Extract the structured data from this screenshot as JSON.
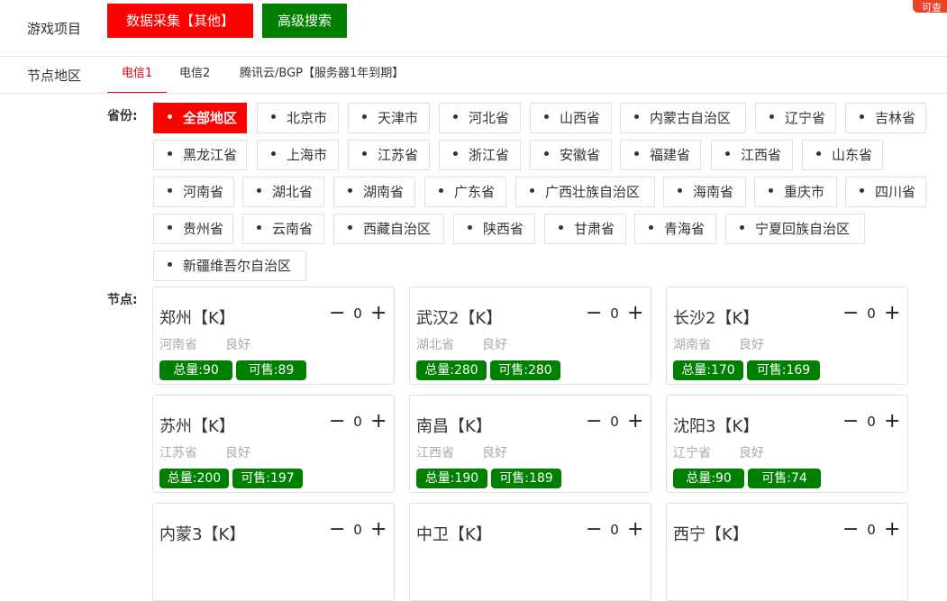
{
  "header": {
    "label": "游戏项目",
    "data_collect_button": "数据采集【其他】",
    "advanced_search_button": "高级搜索",
    "corner_tag": "可查"
  },
  "region": {
    "label": "节点地区",
    "tabs": [
      "电信1",
      "电信2",
      "腾讯云/BGP【服务器1年到期】"
    ],
    "active_tab": "电信1"
  },
  "provinces": {
    "label": "省份:",
    "items": [
      "全部地区",
      "北京市",
      "天津市",
      "河北省",
      "山西省",
      "内蒙古自治区",
      "辽宁省",
      "吉林省",
      "黑龙江省",
      "上海市",
      "江苏省",
      "浙江省",
      "安徽省",
      "福建省",
      "江西省",
      "山东省",
      "河南省",
      "湖北省",
      "湖南省",
      "广东省",
      "广西壮族自治区",
      "海南省",
      "重庆市",
      "四川省",
      "贵州省",
      "云南省",
      "西藏自治区",
      "陕西省",
      "甘肃省",
      "青海省",
      "宁夏回族自治区",
      "新疆维吾尔自治区"
    ],
    "active": "全部地区"
  },
  "nodes": {
    "label": "节点:",
    "cards": [
      {
        "name": "郑州【K】",
        "qty": "0",
        "province": "河南省",
        "status": "良好",
        "total": "总量:90",
        "avail": "可售:89"
      },
      {
        "name": "武汉2【K】",
        "qty": "0",
        "province": "湖北省",
        "status": "良好",
        "total": "总量:280",
        "avail": "可售:280"
      },
      {
        "name": "长沙2【K】",
        "qty": "0",
        "province": "湖南省",
        "status": "良好",
        "total": "总量:170",
        "avail": "可售:169"
      },
      {
        "name": "苏州【K】",
        "qty": "0",
        "province": "江苏省",
        "status": "良好",
        "total": "总量:200",
        "avail": "可售:197"
      },
      {
        "name": "南昌【K】",
        "qty": "0",
        "province": "江西省",
        "status": "良好",
        "total": "总量:190",
        "avail": "可售:189"
      },
      {
        "name": "沈阳3【K】",
        "qty": "0",
        "province": "辽宁省",
        "status": "良好",
        "total": "总量:90",
        "avail": "可售:74"
      },
      {
        "name": "内蒙3【K】",
        "qty": "0",
        "province": "",
        "status": "",
        "total": "",
        "avail": ""
      },
      {
        "name": "中卫【K】",
        "qty": "0",
        "province": "",
        "status": "",
        "total": "",
        "avail": ""
      },
      {
        "name": "西宁【K】",
        "qty": "0",
        "province": "",
        "status": "",
        "total": "",
        "avail": ""
      }
    ]
  },
  "colors": {
    "accent_red": "#ff0000",
    "accent_green": "#008000",
    "tab_active": "#e60012"
  },
  "icons": {
    "minus": "minus-icon",
    "plus": "plus-icon",
    "bullet": "bullet-dot-icon"
  }
}
